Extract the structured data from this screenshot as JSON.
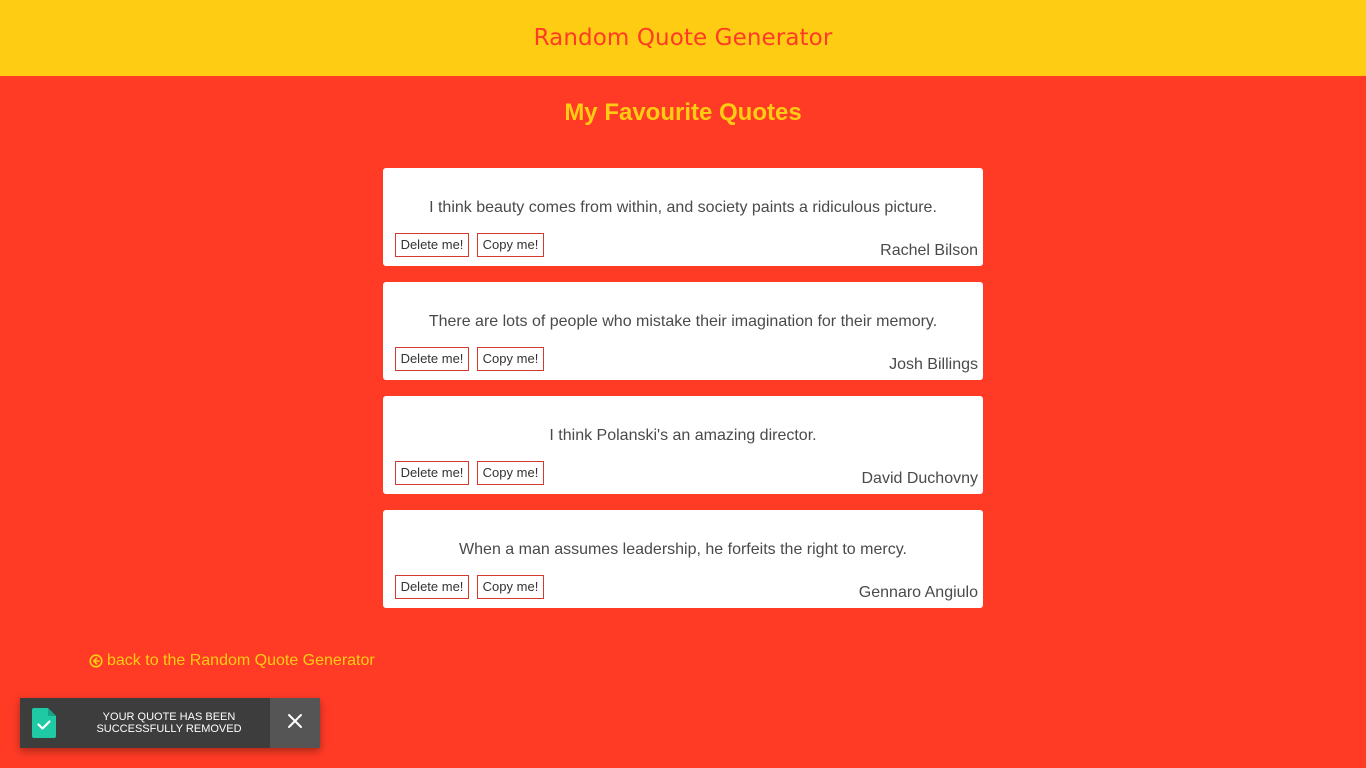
{
  "header": {
    "title": "Random Quote Generator"
  },
  "page": {
    "heading": "My Favourite Quotes"
  },
  "quotes": [
    {
      "text": "I think beauty comes from within, and society paints a ridiculous picture.",
      "author": "Rachel Bilson",
      "delete_label": "Delete me!",
      "copy_label": "Copy me!"
    },
    {
      "text": "There are lots of people who mistake their imagination for their memory.",
      "author": "Josh Billings",
      "delete_label": "Delete me!",
      "copy_label": "Copy me!"
    },
    {
      "text": "I think Polanski's an amazing director.",
      "author": "David Duchovny",
      "delete_label": "Delete me!",
      "copy_label": "Copy me!"
    },
    {
      "text": "When a man assumes leadership, he forfeits the right to mercy.",
      "author": "Gennaro Angiulo",
      "delete_label": "Delete me!",
      "copy_label": "Copy me!"
    }
  ],
  "back_link": {
    "label": "back to the Random Quote Generator",
    "icon": "arrow-circle-left-icon"
  },
  "toast": {
    "message": "YOUR QUOTE HAS BEEN SUCCESSFULLY REMOVED",
    "icon": "file-check-icon",
    "close_icon": "close-icon"
  },
  "colors": {
    "background": "#ff3b26",
    "header_bg": "#ffcc14",
    "accent_yellow": "#ffcc14",
    "card_bg": "#ffffff",
    "toast_bg": "#3d3d3d",
    "toast_icon": "#1ec9a4"
  }
}
